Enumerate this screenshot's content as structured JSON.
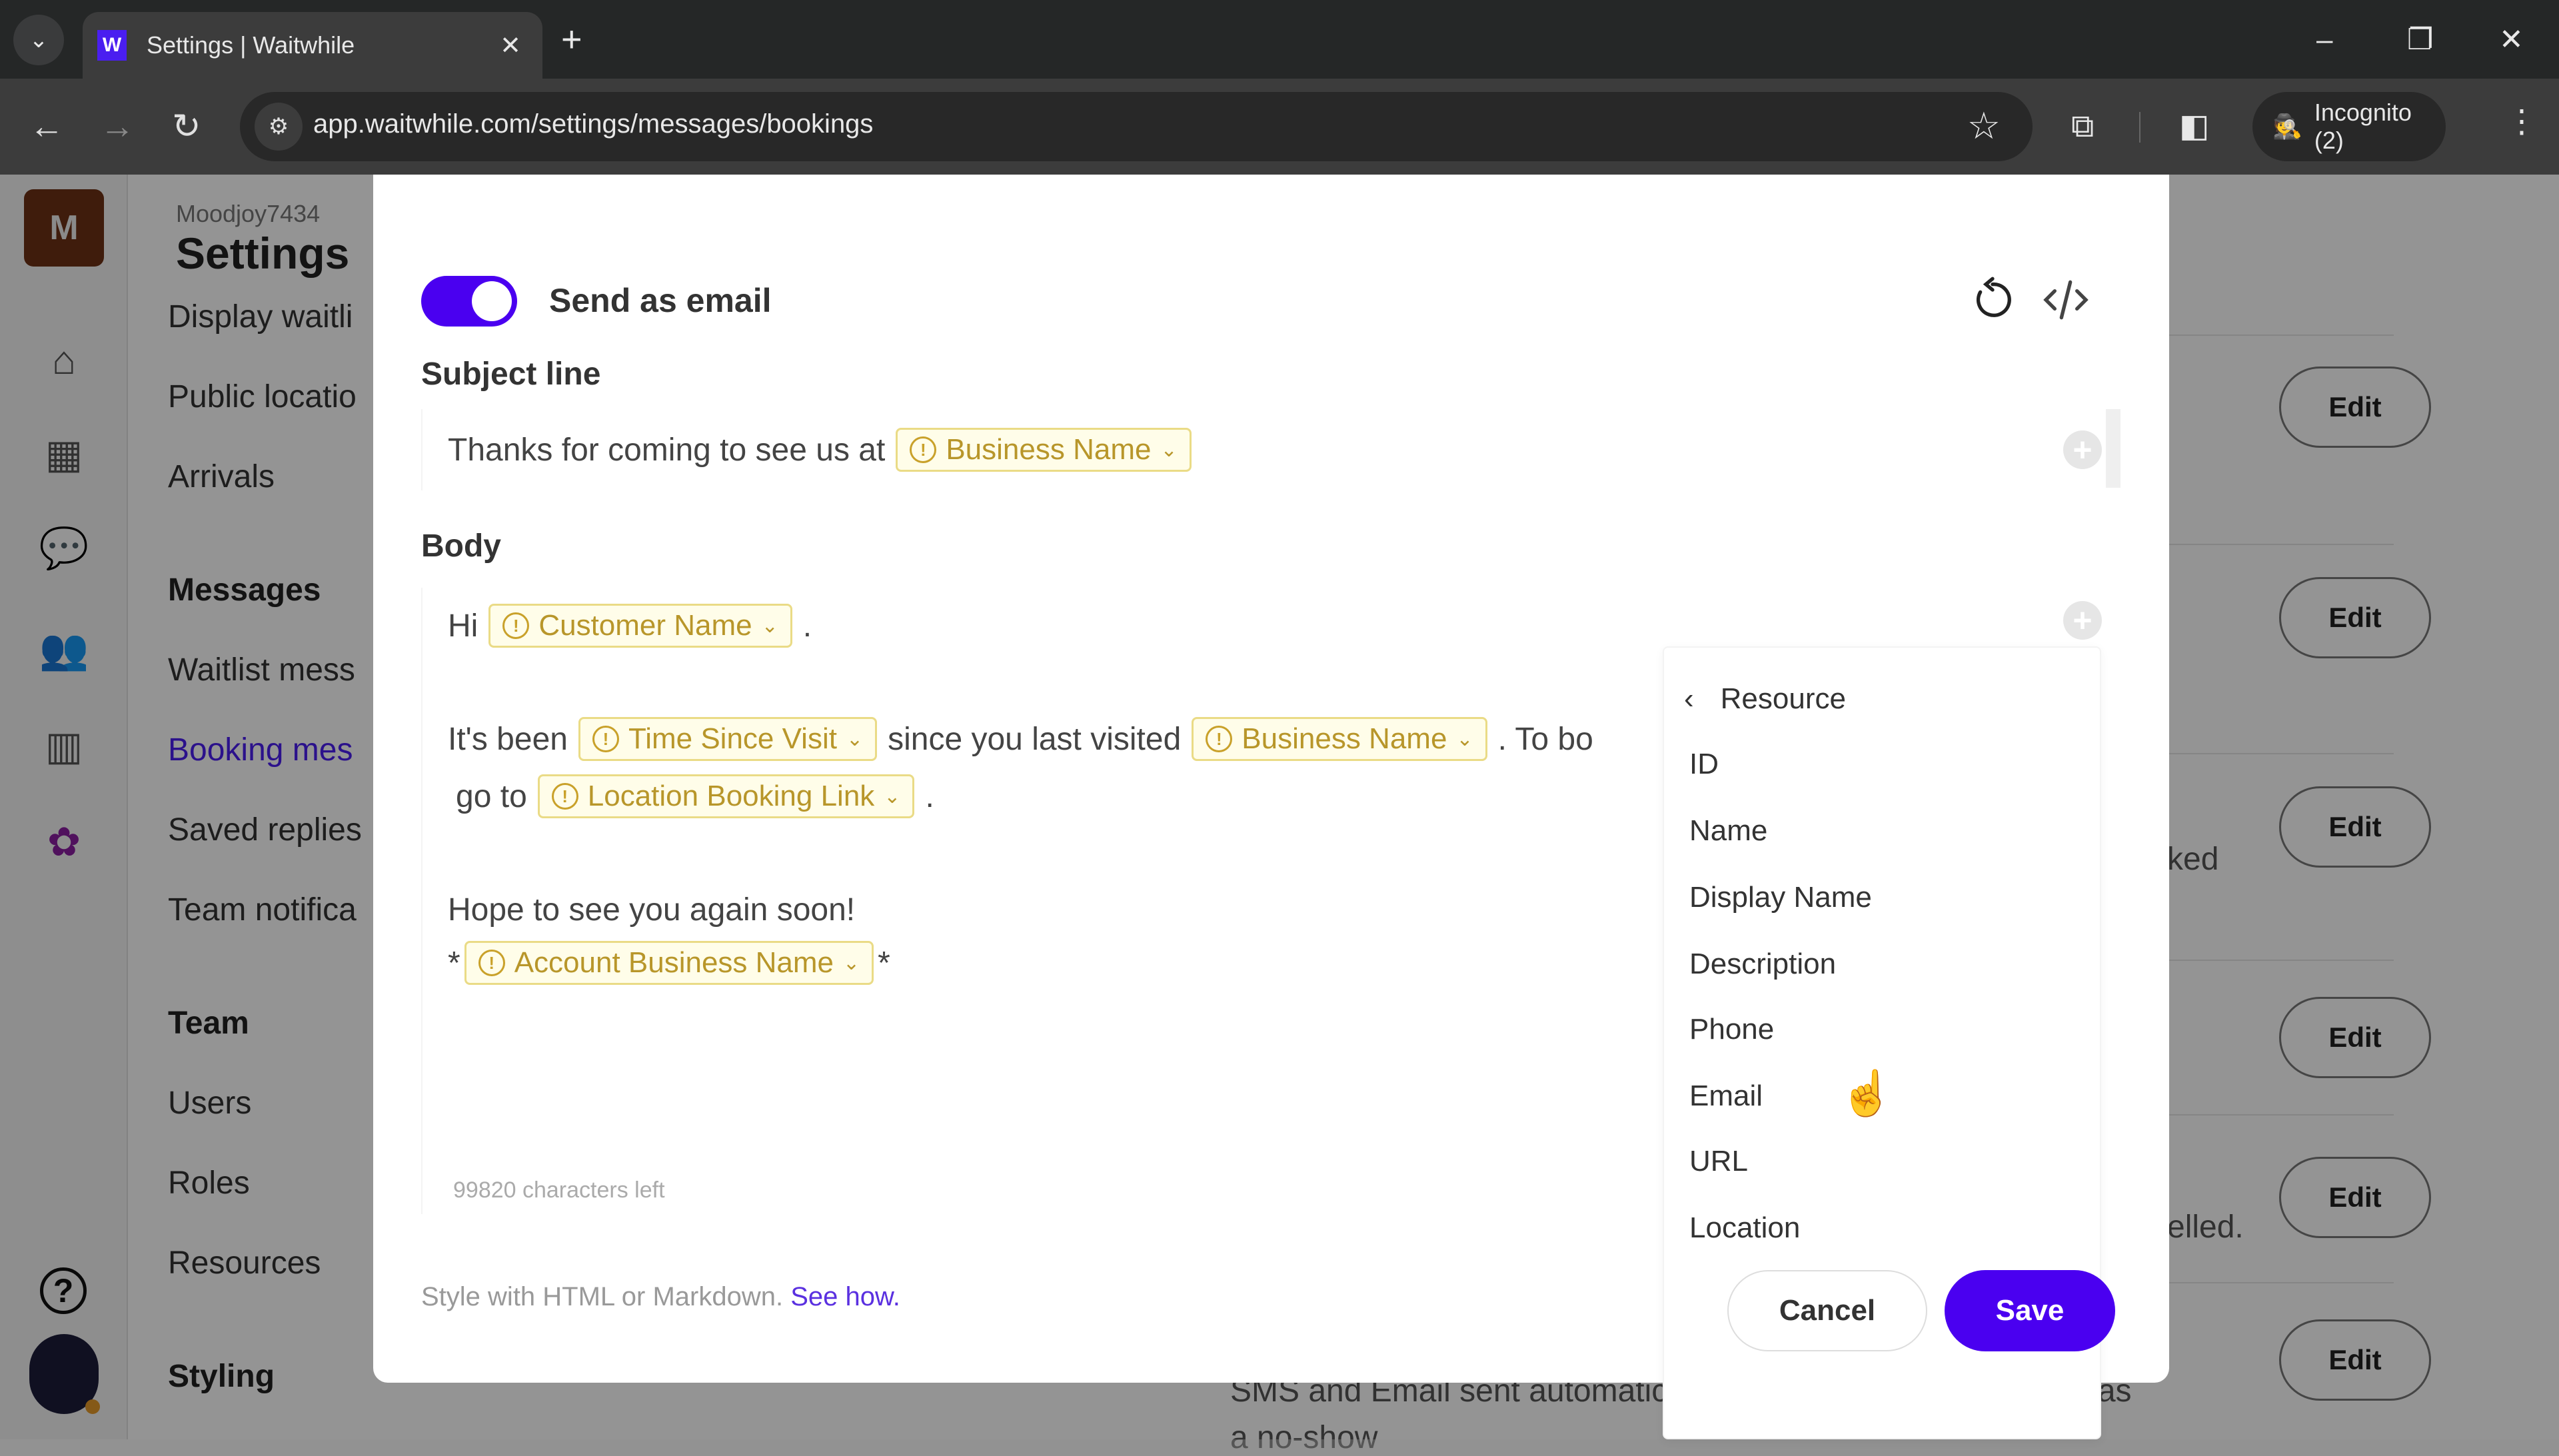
{
  "browser": {
    "tab_title": "Settings | Waitwhile",
    "favicon_letter": "W",
    "url": "app.waitwhile.com/settings/messages/bookings",
    "incognito_label": "Incognito (2)",
    "icons": {
      "tab_search": "⌄",
      "tab_close": "✕",
      "new_tab": "+",
      "minimize": "–",
      "restore": "❐",
      "close": "✕",
      "back": "←",
      "forward": "→",
      "reload": "↻",
      "site_info": "⚙",
      "star": "☆",
      "extensions": "⧉",
      "sidepanel": "◧",
      "incognito": "🕵",
      "menu": "⋮"
    }
  },
  "rail": {
    "brand_letter": "M",
    "icons": {
      "home": "⌂",
      "calendar": "▦",
      "chat": "💬",
      "users": "👥",
      "analytics": "▥",
      "settings": "✿",
      "help": "?"
    }
  },
  "nav": {
    "account": "Moodjoy7434",
    "title": "Settings",
    "items": [
      {
        "label": "Display waitli",
        "type": "item"
      },
      {
        "label": "Public locatio",
        "type": "item"
      },
      {
        "label": "Arrivals",
        "type": "item"
      },
      {
        "label": "Messages",
        "type": "heading"
      },
      {
        "label": "Waitlist mess",
        "type": "item"
      },
      {
        "label": "Booking mes",
        "type": "active"
      },
      {
        "label": "Saved replies",
        "type": "item"
      },
      {
        "label": "Team notifica",
        "type": "item"
      },
      {
        "label": "Team",
        "type": "heading"
      },
      {
        "label": "Users",
        "type": "item"
      },
      {
        "label": "Roles",
        "type": "item"
      },
      {
        "label": "Resources",
        "type": "item"
      },
      {
        "label": "Styling",
        "type": "heading"
      }
    ]
  },
  "content": {
    "edit_label": "Edit",
    "row_fragments": [
      "ked",
      "elled.",
      "SMS and Email sent automatically when customer is marked as",
      "a no-show"
    ]
  },
  "modal": {
    "send_as_email": {
      "label": "Send as email",
      "enabled": true
    },
    "icons": {
      "reset": "reset-icon",
      "code": "code-icon",
      "add": "+",
      "warning": "!",
      "caret": "⌄"
    },
    "subject": {
      "label": "Subject line",
      "text": "Thanks for coming to see us at",
      "chip": "Business Name"
    },
    "body": {
      "label": "Body",
      "line1": {
        "prefix": "Hi",
        "chip": "Customer Name",
        "suffix": "."
      },
      "line2": {
        "prefix": "It's been",
        "chip1": "Time Since Visit",
        "middle": "since you last visited",
        "chip2": "Business Name",
        "suffix": ". To bo"
      },
      "line3": {
        "prefix": "go to",
        "chip": "Location Booking Link",
        "suffix": "."
      },
      "line4": "Hope to see you again soon!",
      "line5": {
        "prefix": "*",
        "chip": "Account Business Name",
        "suffix": "*"
      },
      "chars_left": "99820 characters left"
    },
    "hint": {
      "text": "Style with HTML or Markdown.",
      "link": "See how."
    },
    "dropdown": {
      "back_label": "Resource",
      "back_icon": "‹",
      "items": [
        "ID",
        "Name",
        "Display Name",
        "Description",
        "Phone",
        "Email",
        "URL",
        "Location"
      ]
    },
    "cancel_label": "Cancel",
    "save_label": "Save"
  }
}
